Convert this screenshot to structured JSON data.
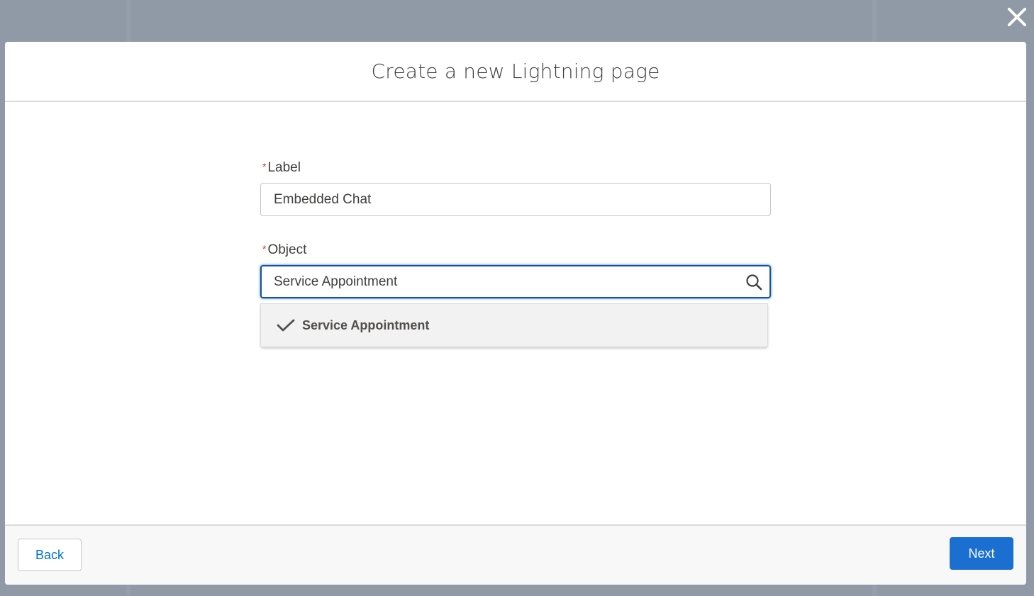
{
  "modal": {
    "title": "Create a new Lightning page"
  },
  "form": {
    "label_field": {
      "required_marker": "*",
      "label": "Label",
      "value": "Embedded Chat"
    },
    "object_field": {
      "required_marker": "*",
      "label": "Object",
      "value": "Service Appointment",
      "icon": "search-icon"
    },
    "dropdown": {
      "options": [
        {
          "label": "Service Appointment",
          "selected": true,
          "icon": "check-icon"
        }
      ]
    }
  },
  "footer": {
    "back_label": "Back",
    "next_label": "Next"
  },
  "colors": {
    "backdrop": "#8f9aa6",
    "brand_blue": "#1b6fd0",
    "link_blue": "#0070d2",
    "required_red": "#c23934"
  }
}
